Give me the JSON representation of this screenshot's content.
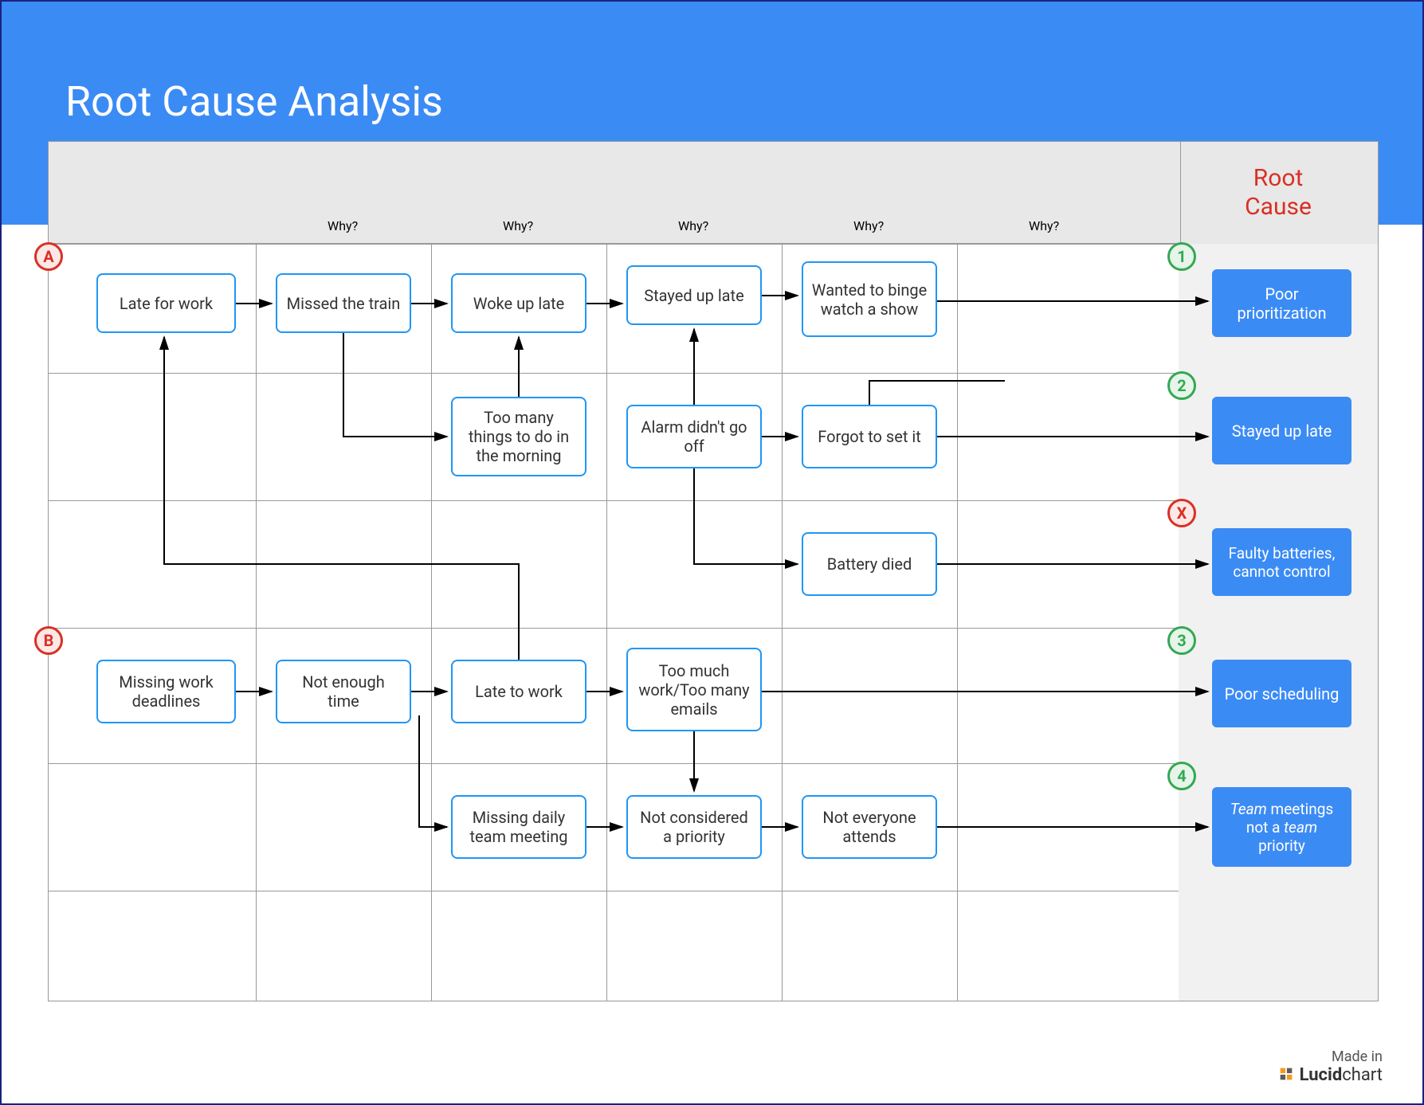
{
  "title": "Root Cause Analysis",
  "columns": {
    "whys": [
      "Why?",
      "Why?",
      "Why?",
      "Why?",
      "Why?"
    ],
    "root_cause_header": "Root\nCause"
  },
  "badges": {
    "A": "A",
    "B": "B",
    "1": "1",
    "2": "2",
    "X": "X",
    "3": "3",
    "4": "4"
  },
  "nodes": {
    "a0": "Late for work",
    "a1": "Missed the train",
    "a2": "Woke up late",
    "a3": "Stayed up late",
    "a4": "Wanted to binge watch a show",
    "a2b": "Too many things to do in the morning",
    "a3b": "Alarm didn't go off",
    "a4b": "Forgot to set it",
    "a4c": "Battery died",
    "b0": "Missing work deadlines",
    "b1": "Not enough time",
    "b2": "Late to work",
    "b3": "Too much work/Too many emails",
    "b2b": "Missing daily team meeting",
    "b3b": "Not considered a priority",
    "b4b": "Not everyone attends"
  },
  "root_causes": {
    "r1": "Poor prioritization",
    "r2": "Stayed up late",
    "rx": "Faulty batteries, cannot control",
    "r3": "Poor scheduling",
    "r4_html": "<i>Team</i> meetings not a <i>team</i> priority"
  },
  "footer": {
    "made_in": "Made in",
    "brand": "Lucidchart"
  }
}
